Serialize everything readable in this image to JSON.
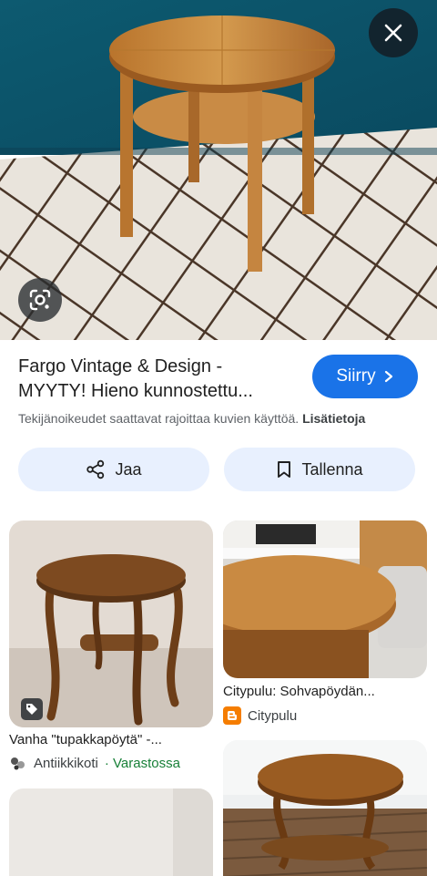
{
  "hero": {
    "close_icon": "close-icon",
    "lens_icon": "google-lens-icon"
  },
  "result": {
    "title_line1": "Fargo Vintage & Design -",
    "title_line2": "MYYTY! Hieno kunnostettu...",
    "visit_label": "Siirry",
    "copyright_text": "Tekijänoikeudet saattavat rajoittaa kuvien käyttöä.",
    "learn_more": "Lisätietoja"
  },
  "actions": {
    "share_label": "Jaa",
    "save_label": "Tallenna"
  },
  "related": [
    {
      "title": "Vanha \"tupakkapöytä\" -...",
      "source": "Antiikkikoti",
      "status": "Varastossa",
      "icon": "tag-icon"
    },
    {
      "title": "Citypulu: Sohvapöydän...",
      "source": "Citypulu",
      "icon": "blogger-icon"
    },
    {
      "title": "",
      "source": ""
    },
    {
      "title": "",
      "source": ""
    }
  ],
  "colors": {
    "accent": "#1a73e8",
    "chip_bg": "#e8f0fe",
    "in_stock": "#188038"
  }
}
